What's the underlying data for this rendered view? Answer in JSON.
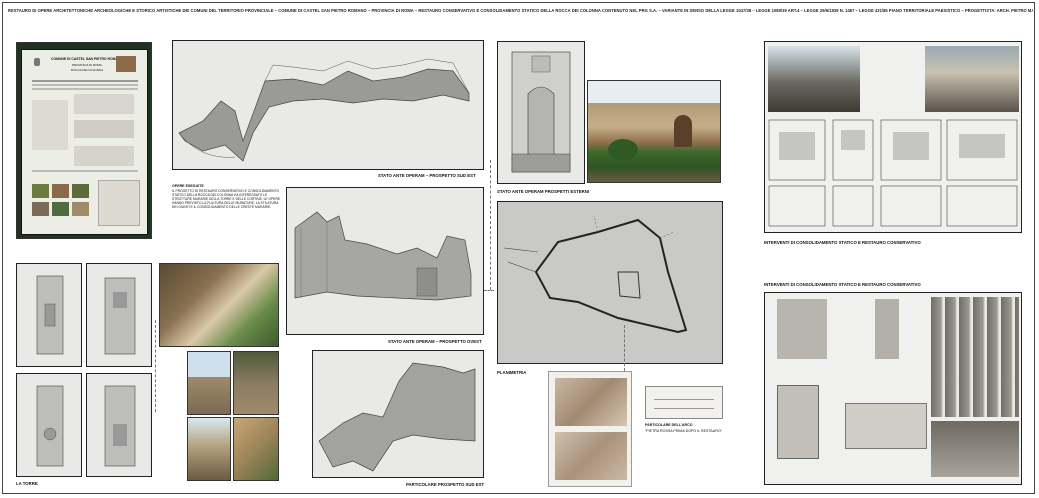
{
  "header": {
    "text": "RESTAURO DI OPERE ARCHITETTONICHE ARCHEOLOGICHE E STORICO ARTISTICHE DEI COMUNI DEL TERRITORIO PROVINCIALE – COMUNE DI CASTEL SAN PIETRO ROMANO – PROVINCIA DI ROMA – RESTAURO CONSERVATIVO E CONSOLIDAMENTO STATICO DELLA ROCCA DEI COLONNA CONTENUTO NEL PRG S.A. – VARIANTE IN SENSO DELLA LEGGE 1047/38 – LEGGE 1089/39 ART.4 – LEGGE 29/6/1939 N. 1497 – LEGGE 431/85 PIANO TERRITORIALE PAESISTICO – PROGETTISTA: ARCH. PIETRO MASSANTE E FEDORA SLAGO DEL PROVVEDITORATO"
  },
  "signboard": {
    "title": "COMUNE DI CASTEL SAN PIETRO ROMANO",
    "subtitle1": "PROVINCIA DI ROMA",
    "subtitle2": "ROCCA DEI COLONNA"
  },
  "note": {
    "heading": "OPERE ESEGUITE",
    "body": "IL PROGETTO DI RESTAURO CONSERVATIVO E CONSOLIDAMENTO STATICO DELLA ROCCA DEI COLONNA HA INTERESSATO LE STRUTTURE MURARIE DELLA TORRE E DELLE CORTINE. LE OPERE HANNO PREVISTO LA PULITURA DELLE MURATURE, LA STILATURA DEI GIUNTI E IL CONSOLIDAMENTO DELLE CRESTE MURARIE."
  },
  "captions": {
    "sud_est": "STATO ANTE OPERAM – PROSPETTO SUD EST",
    "est": "STATO ANTE OPERAM PROSPETTI ESTERNI",
    "ovest": "STATO ANTE OPERAM – PROSPETTO OVEST",
    "planimetria": "PLANIMETRIA",
    "torre": "LA TORRE",
    "particolare": "PARTICOLARE PROSPETTO SUD EST",
    "interventi1": "INTERVENTI DI CONSOLIDAMENTO STATICO E RESTAURO CONSERVATIVO",
    "interventi2": "INTERVENTI DI CONSOLIDAMENTO STATICO E RESTAURO CONSERVATIVO",
    "stone_note1": "PARTICOLARE DELL'ARCO",
    "stone_note2": "\"PIETRA ROSSA PRIMA DOPO IL RESTAURO\""
  },
  "colors": {
    "paper": "#e9e9e7",
    "sky": "#dbe8f0",
    "stone": "#a08a6a",
    "green": "#4f7a34",
    "dark_green": "#1f3d22"
  }
}
